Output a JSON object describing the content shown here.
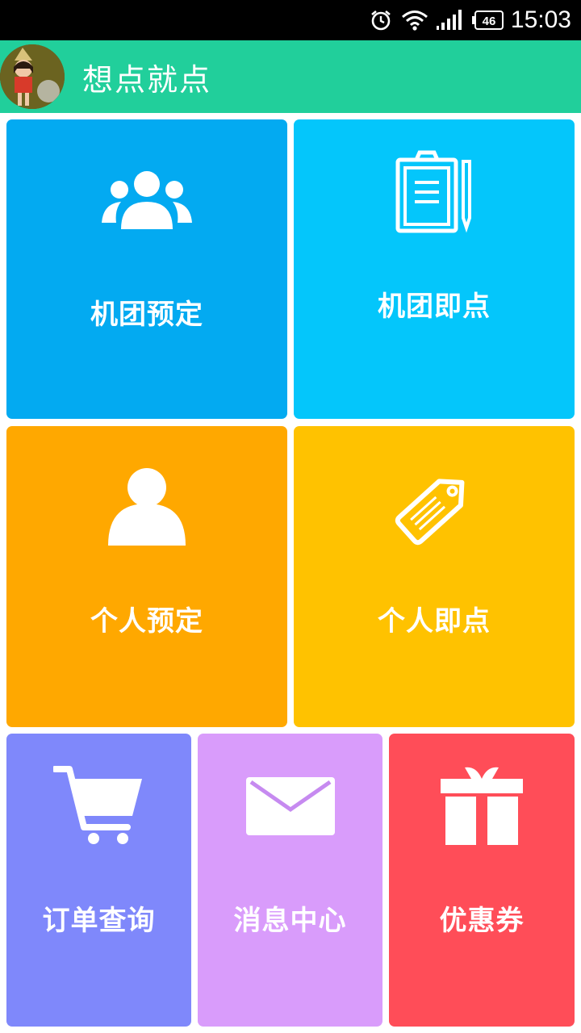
{
  "status_bar": {
    "time": "15:03",
    "battery_level": "46",
    "icons": [
      "alarm-icon",
      "wifi-icon",
      "signal-icon",
      "battery-icon"
    ]
  },
  "app_bar": {
    "title": "想点就点",
    "background": "#21cf9b"
  },
  "tiles": [
    {
      "label": "机团预定",
      "icon": "group-icon",
      "color": "#03aaf1"
    },
    {
      "label": "机团即点",
      "icon": "clipboard-icon",
      "color": "#04c6fb"
    },
    {
      "label": "个人预定",
      "icon": "person-icon",
      "color": "#ffa800"
    },
    {
      "label": "个人即点",
      "icon": "tag-icon",
      "color": "#ffc200"
    },
    {
      "label": "订单查询",
      "icon": "cart-icon",
      "color": "#7f88fb"
    },
    {
      "label": "消息中心",
      "icon": "envelope-icon",
      "color": "#d99cfb"
    },
    {
      "label": "优惠券",
      "icon": "gift-icon",
      "color": "#ff4d58"
    }
  ]
}
